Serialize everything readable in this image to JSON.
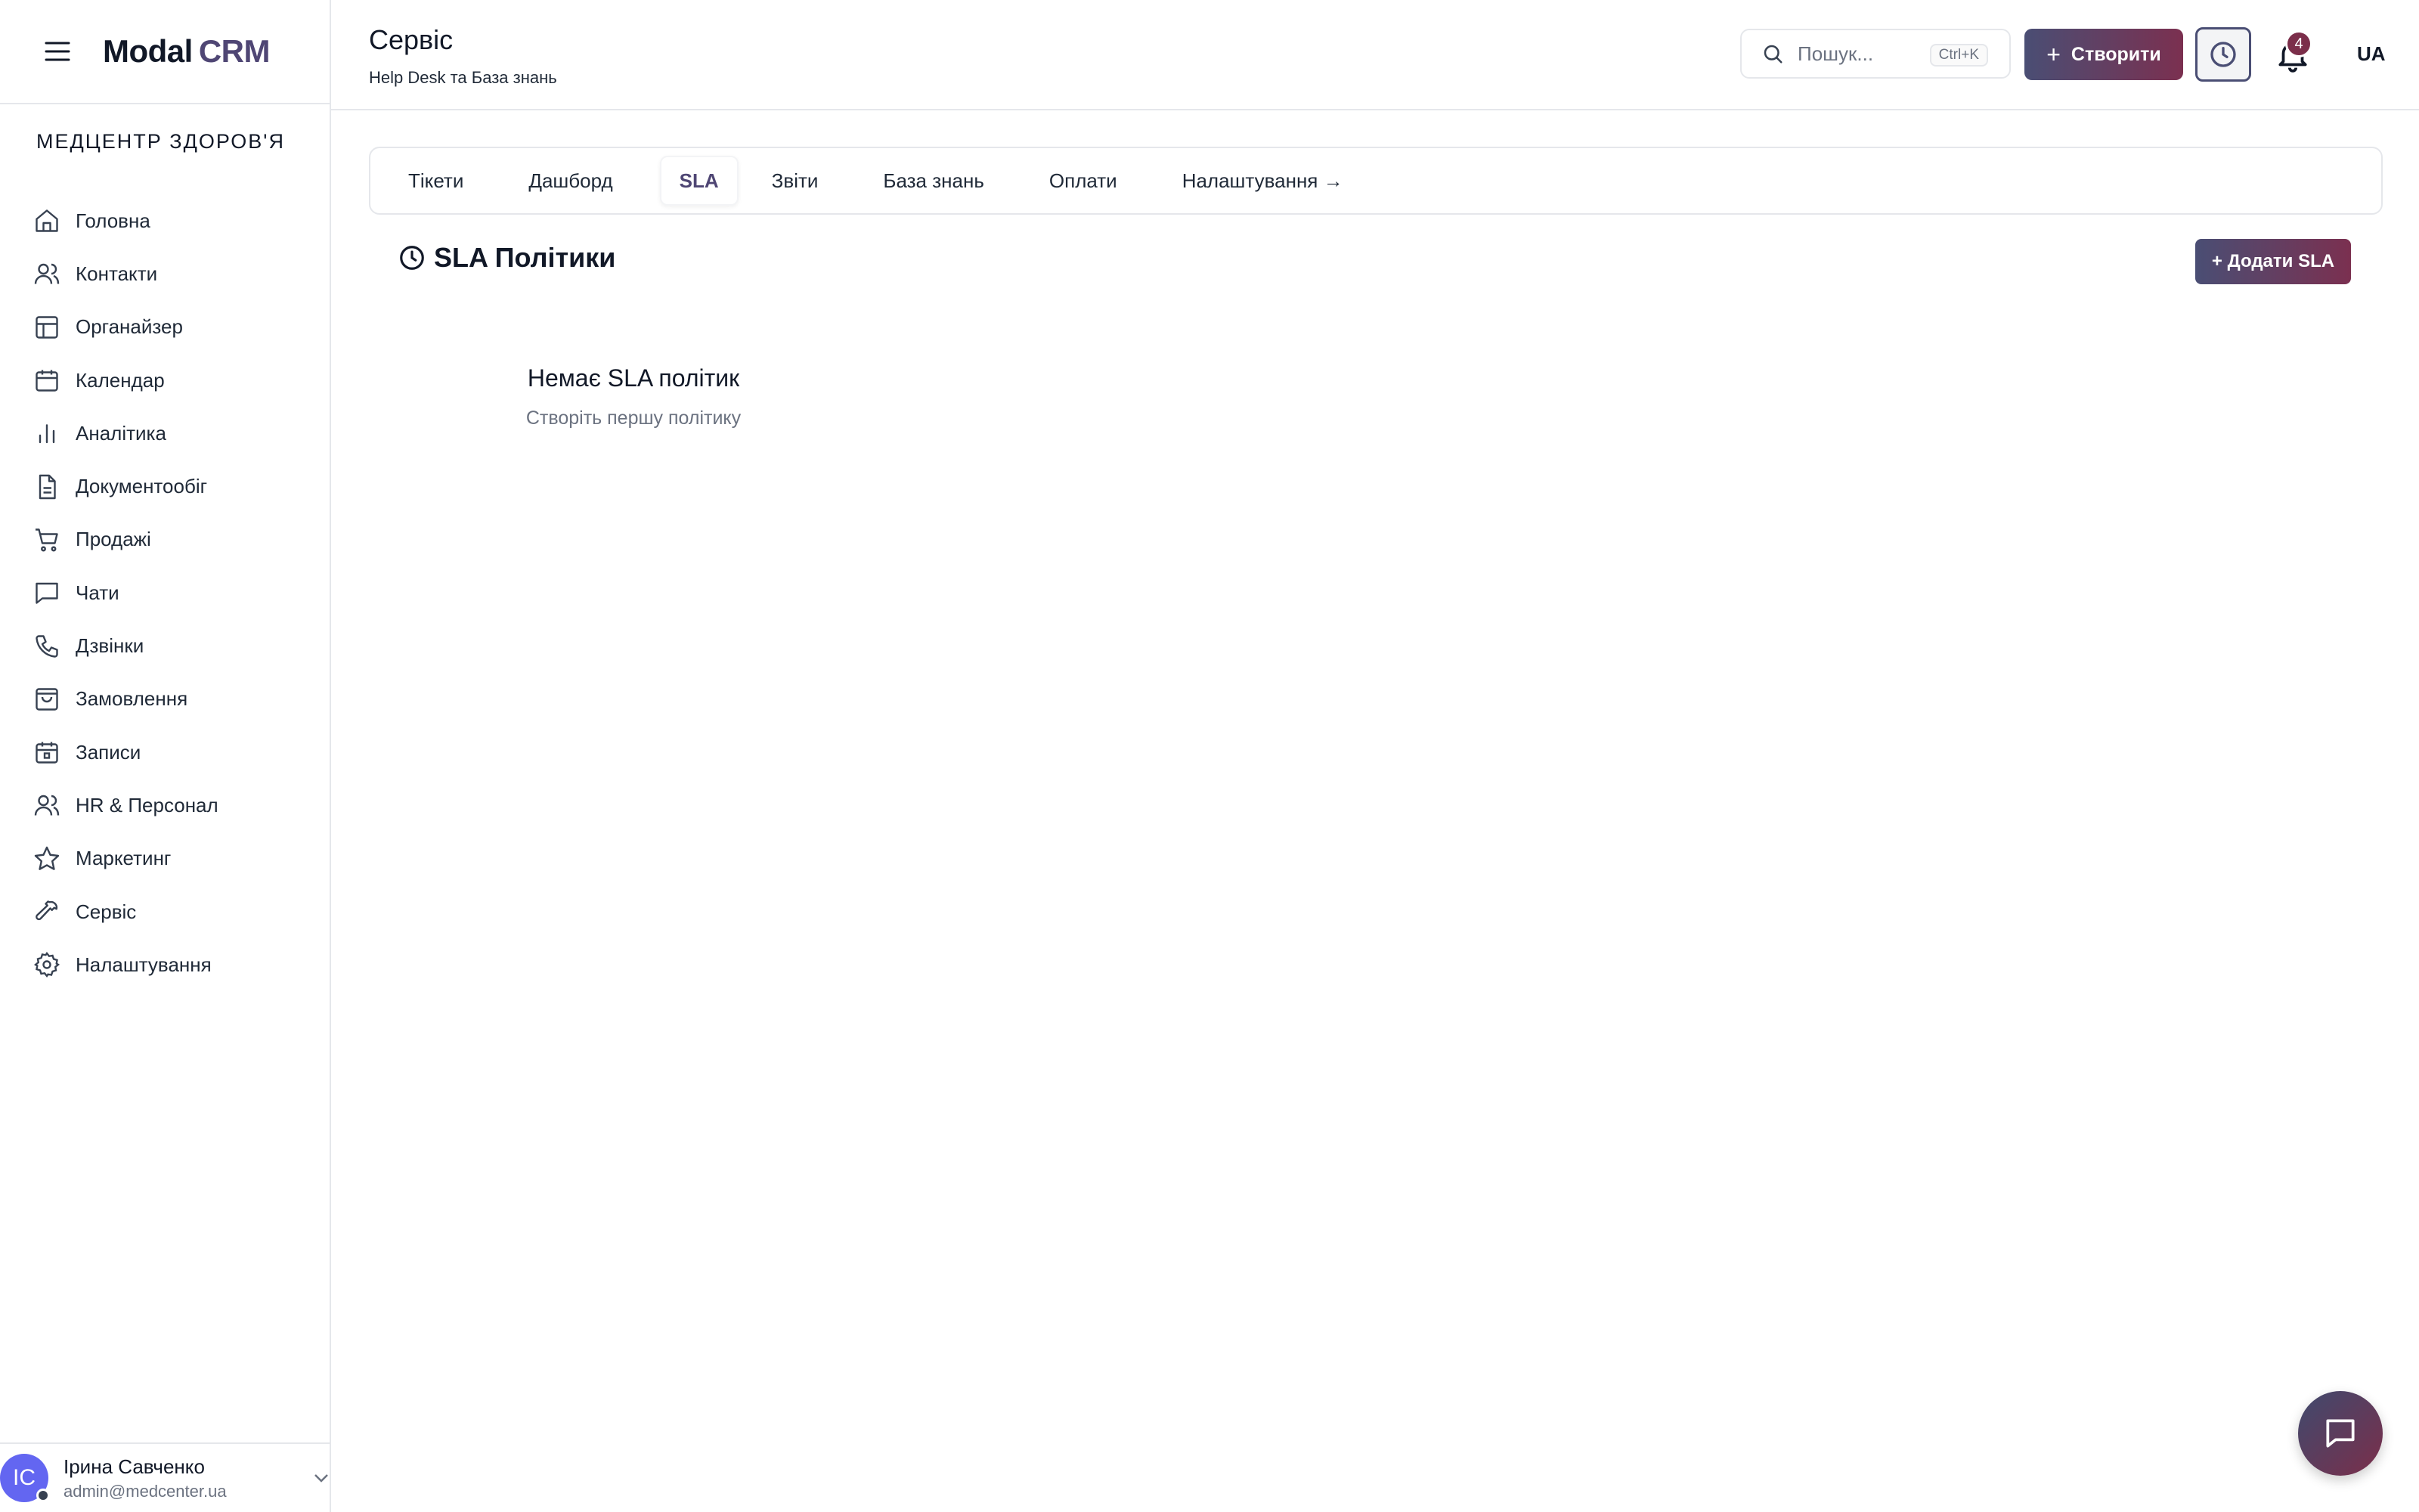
{
  "app": {
    "logo_main": "Modal",
    "logo_accent": "CRM"
  },
  "sidebar": {
    "org": "МЕДЦЕНТР ЗДОРОВ'Я",
    "items": [
      {
        "label": "Головна",
        "icon": "home-icon"
      },
      {
        "label": "Контакти",
        "icon": "users-icon"
      },
      {
        "label": "Органайзер",
        "icon": "layout-icon"
      },
      {
        "label": "Календар",
        "icon": "calendar-icon"
      },
      {
        "label": "Аналітика",
        "icon": "bar-chart-icon"
      },
      {
        "label": "Документообіг",
        "icon": "file-icon"
      },
      {
        "label": "Продажі",
        "icon": "cart-icon"
      },
      {
        "label": "Чати",
        "icon": "chat-icon"
      },
      {
        "label": "Дзвінки",
        "icon": "phone-icon"
      },
      {
        "label": "Замовлення",
        "icon": "shopping-bag-icon"
      },
      {
        "label": "Записи",
        "icon": "calendar-check-icon"
      },
      {
        "label": "HR & Персонал",
        "icon": "team-icon"
      },
      {
        "label": "Маркетинг",
        "icon": "star-icon"
      },
      {
        "label": "Сервіс",
        "icon": "wrench-icon"
      },
      {
        "label": "Налаштування",
        "icon": "gear-icon"
      }
    ],
    "user": {
      "initials": "ІС",
      "name": "Ірина Савченко",
      "email": "admin@medcenter.ua"
    }
  },
  "header": {
    "title": "Сервіс",
    "subtitle": "Help Desk та База знань",
    "search_placeholder": "Пошук...",
    "search_shortcut": "Ctrl+K",
    "create_label": "Створити",
    "notifications_count": "4",
    "lang": "UA"
  },
  "tabs": [
    {
      "label": "Тікети",
      "active": false
    },
    {
      "label": "Дашборд",
      "active": false
    },
    {
      "label": "SLA",
      "active": true
    },
    {
      "label": "Звіти",
      "active": false
    },
    {
      "label": "База знань",
      "active": false
    },
    {
      "label": "Оплати",
      "active": false
    },
    {
      "label": "Налаштування →",
      "active": false
    }
  ],
  "section": {
    "title": "SLA Політики",
    "add_label": "+ Додати SLA",
    "empty_title": "Немає SLA політик",
    "empty_subtitle": "Створіть першу політику"
  },
  "colors": {
    "accent_start": "#4a4e74",
    "accent_end": "#7b3050",
    "logo_accent": "#4f4674"
  }
}
